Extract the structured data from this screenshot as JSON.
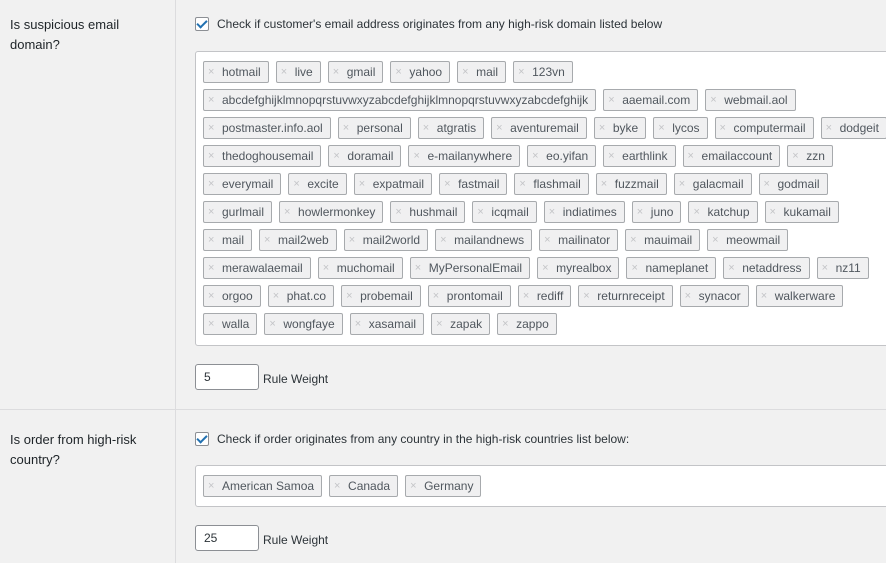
{
  "email_rule": {
    "label": "Is suspicious email domain?",
    "checkbox_text": "Check if customer's email address originates from any high-risk domain listed below",
    "checked": true,
    "domains": [
      "hotmail",
      "live",
      "gmail",
      "yahoo",
      "mail",
      "123vn",
      "abcdefghijklmnopqrstuvwxyzabcdefghijklmnopqrstuvwxyzabcdefghijk",
      "aaemail.com",
      "webmail.aol",
      "postmaster.info.aol",
      "personal",
      "atgratis",
      "aventuremail",
      "byke",
      "lycos",
      "computermail",
      "dodgeit",
      "thedoghousemail",
      "doramail",
      "e-mailanywhere",
      "eo.yifan",
      "earthlink",
      "emailaccount",
      "zzn",
      "everymail",
      "excite",
      "expatmail",
      "fastmail",
      "flashmail",
      "fuzzmail",
      "galacmail",
      "godmail",
      "gurlmail",
      "howlermonkey",
      "hushmail",
      "icqmail",
      "indiatimes",
      "juno",
      "katchup",
      "kukamail",
      "mail",
      "mail2web",
      "mail2world",
      "mailandnews",
      "mailinator",
      "mauimail",
      "meowmail",
      "merawalaemail",
      "muchomail",
      "MyPersonalEmail",
      "myrealbox",
      "nameplanet",
      "netaddress",
      "nz11",
      "orgoo",
      "phat.co",
      "probemail",
      "prontomail",
      "rediff",
      "returnreceipt",
      "synacor",
      "walkerware",
      "walla",
      "wongfaye",
      "xasamail",
      "zapak",
      "zappo"
    ],
    "weight_value": "5",
    "weight_label": "Rule Weight"
  },
  "country_rule": {
    "label": "Is order from high-risk country?",
    "checkbox_text": "Check if order originates from any country in the high-risk countries list below:",
    "checked": true,
    "countries": [
      "American Samoa",
      "Canada",
      "Germany"
    ],
    "weight_value": "25",
    "weight_label": "Rule Weight"
  },
  "icons": {
    "remove": "close-icon",
    "check": "checkmark-icon"
  }
}
